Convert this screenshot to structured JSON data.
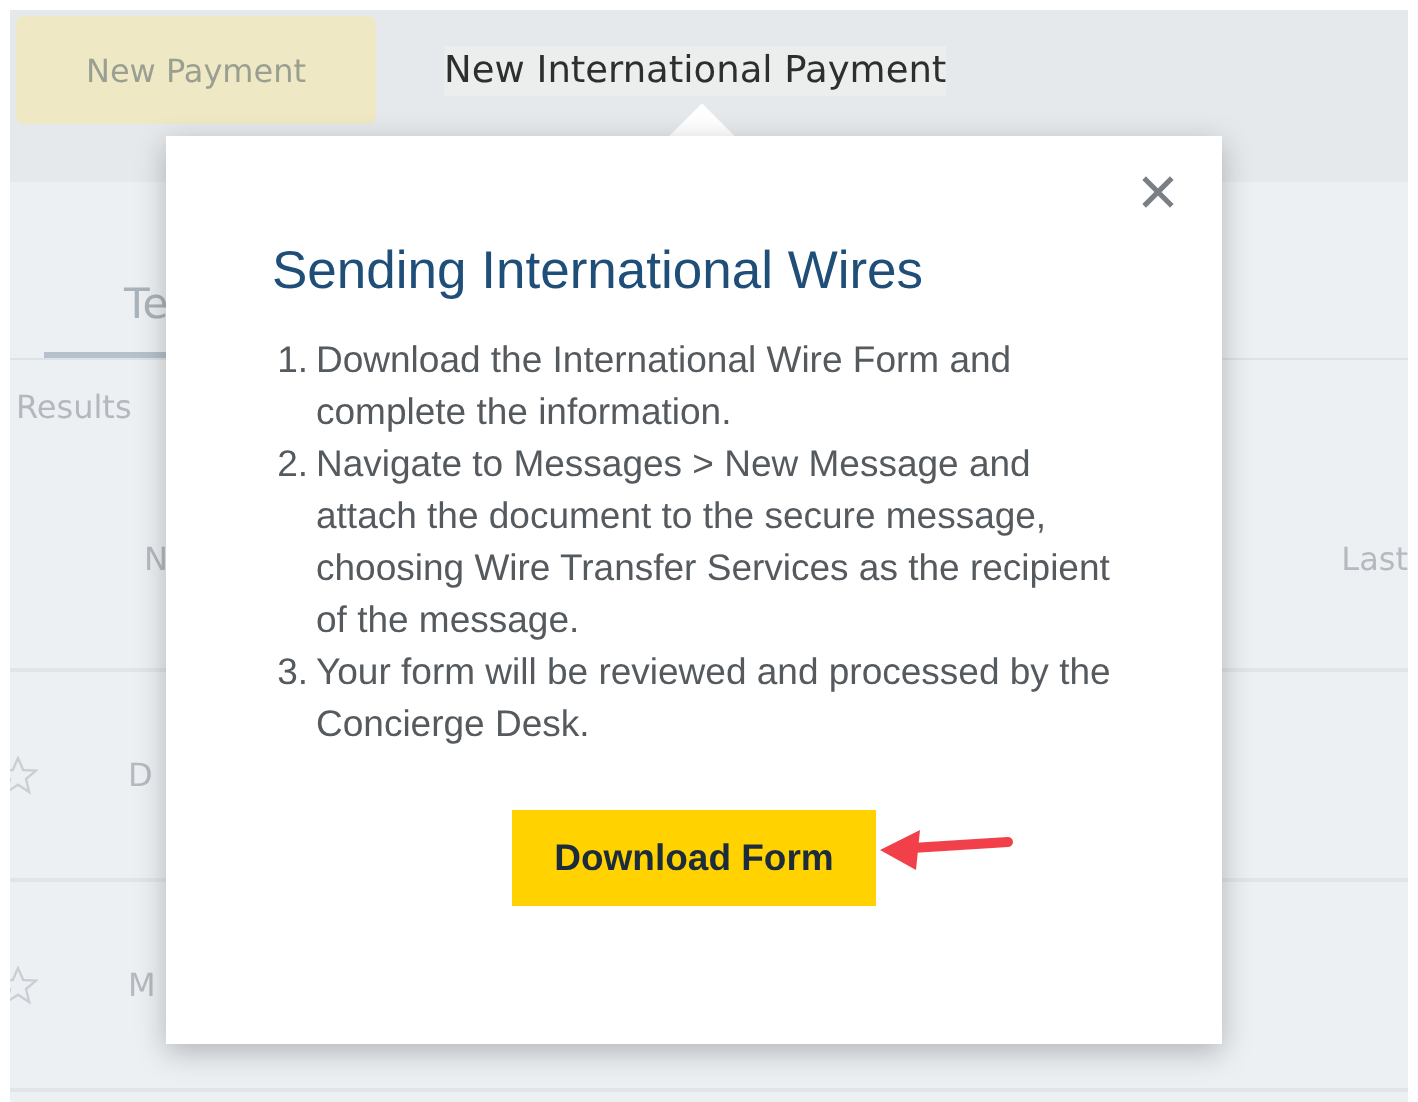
{
  "header": {
    "buttons": [
      {
        "label": "New Payment",
        "kind": "button"
      },
      {
        "label": "New International Payment",
        "kind": "link"
      }
    ]
  },
  "tabs": [
    {
      "label": "Te",
      "selected": true
    }
  ],
  "results_label": "Results",
  "table": {
    "columns": [
      "N",
      "Last"
    ],
    "rows": [
      {
        "starred": false,
        "column_1": "D"
      },
      {
        "starred": false,
        "column_1": "M"
      }
    ]
  },
  "dialog": {
    "title": "Sending International Wires",
    "steps": [
      {
        "number": "1.",
        "text": "Download the International Wire Form and complete the information."
      },
      {
        "number": "2.",
        "text": "Navigate to Messages > New Message and attach the document to the secure message, choosing Wire Transfer Services as the recipient of the message."
      },
      {
        "number": "3.",
        "text": "Your form will be reviewed and processed by the Concierge Desk."
      }
    ],
    "button": "Download Form"
  }
}
